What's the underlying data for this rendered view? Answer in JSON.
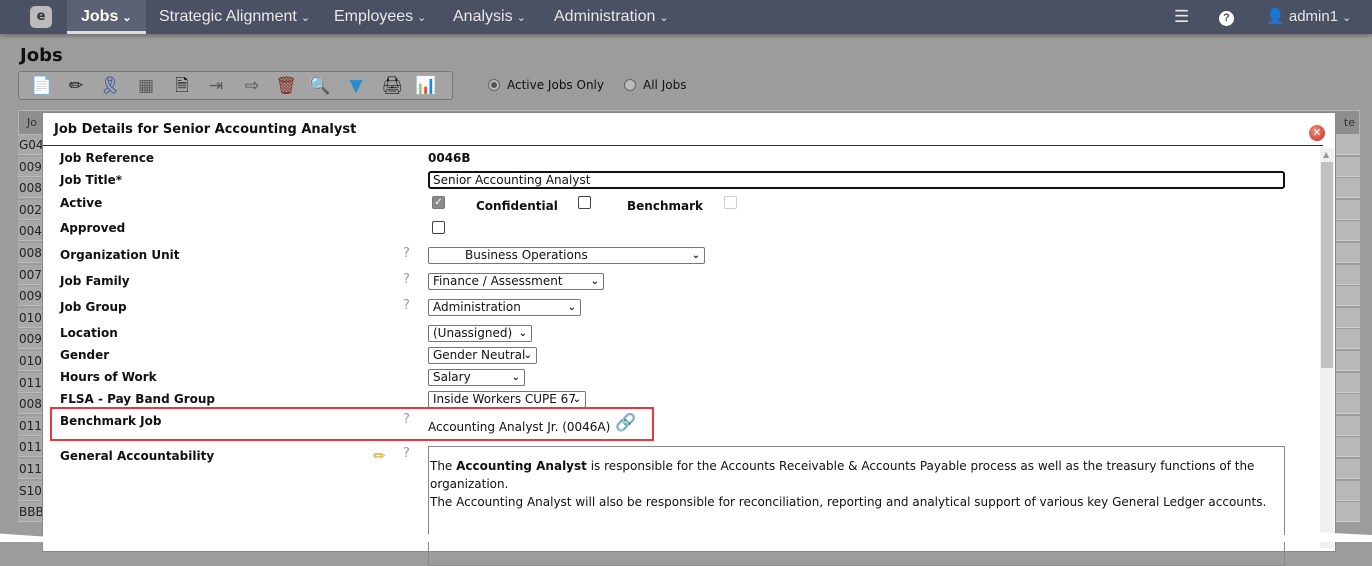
{
  "nav": {
    "logo": "e",
    "menus": [
      {
        "label": "Jobs",
        "active": true
      },
      {
        "label": "Strategic Alignment"
      },
      {
        "label": "Employees"
      },
      {
        "label": "Analysis"
      },
      {
        "label": "Administration"
      }
    ],
    "user": "admin1",
    "icons": [
      "sliders-icon",
      "help-icon",
      "user-icon"
    ]
  },
  "page": {
    "title": "Jobs"
  },
  "toolbar": {
    "icons": [
      "new-job-icon",
      "edit-icon",
      "award-icon",
      "questionnaire-icon",
      "document-icon",
      "import-icon",
      "export-icon",
      "delete-icon",
      "search-icon",
      "filter-icon",
      "print-icon",
      "report-icon"
    ]
  },
  "filter": {
    "active_label": "Active Jobs Only",
    "all_label": "All Jobs",
    "selected": "Active Jobs Only"
  },
  "grid": {
    "header_left": "Jo",
    "header_right": "te",
    "row_ids": [
      "G04",
      "009",
      "008",
      "002",
      "004",
      "008",
      "007",
      "009",
      "010",
      "009",
      "010",
      "011",
      "008",
      "011",
      "011",
      "011",
      "S10",
      "BBB"
    ]
  },
  "modal": {
    "title": "Job Details for Senior Accounting Analyst",
    "labels": {
      "job_reference": "Job Reference",
      "job_title": "Job Title*",
      "active": "Active",
      "confidential": "Confidential",
      "benchmark": "Benchmark",
      "approved": "Approved",
      "org_unit": "Organization Unit",
      "job_family": "Job Family",
      "job_group": "Job Group",
      "location": "Location",
      "gender": "Gender",
      "hours": "Hours of Work",
      "flsa": "FLSA - Pay Band Group",
      "benchmark_job": "Benchmark Job",
      "general_accountability": "General Accountability"
    },
    "values": {
      "job_reference": "0046B",
      "job_title": "Senior Accounting Analyst",
      "active": true,
      "confidential": false,
      "benchmark": false,
      "approved": false,
      "org_unit": "Business Operations",
      "job_family": "Finance / Assessment",
      "job_group": "Administration",
      "location": "(Unassigned)",
      "gender": "Gender Neutral",
      "hours": "Salary",
      "flsa": "Inside Workers CUPE 67",
      "benchmark_job": "Accounting Analyst Jr. (0046A)"
    },
    "description": {
      "p1_pre": "The ",
      "p1_bold": "Accounting Analyst",
      "p1_post": " is responsible for the Accounts Receivable & Accounts Payable process as well as the treasury functions of the organization.",
      "p2": "The Accounting Analyst will also be responsible for reconciliation, reporting and analytical support of various key General Ledger accounts."
    },
    "highlight_color": "#e8383d"
  }
}
